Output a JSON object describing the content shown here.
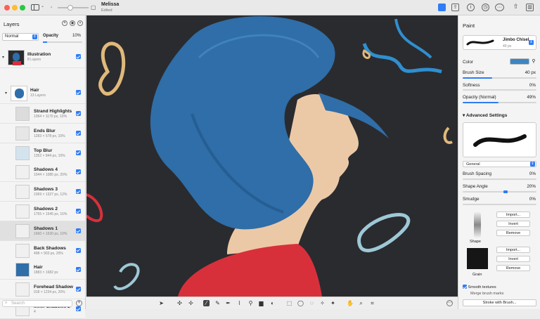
{
  "window": {
    "title": "Melissa",
    "subtitle": "Edited"
  },
  "layers_panel": {
    "title": "Layers",
    "blend_mode": "Normal",
    "opacity_label": "Opacity",
    "opacity_value": "10%",
    "opacity_fraction": 0.1,
    "search_placeholder": "Search",
    "groups": [
      {
        "name": "Illustration",
        "desc": "8 Layers"
      },
      {
        "name": "Hair",
        "desc": "13 Layers"
      }
    ],
    "layers": [
      {
        "name": "Strand Highlights",
        "desc": "1094 × 1170 px, 10%"
      },
      {
        "name": "Ends Blur",
        "desc": "1283 × 578 px, 10%"
      },
      {
        "name": "Top Blur",
        "desc": "1352 × 844 px, 10%"
      },
      {
        "name": "Shadows 4",
        "desc": "1044 × 1085 px, 20%"
      },
      {
        "name": "Shadows 3",
        "desc": "1069 × 1327 px, 12%"
      },
      {
        "name": "Shadows 2",
        "desc": "1755 × 1545 px, 15%"
      },
      {
        "name": "Shadows 1",
        "desc": "1660 × 1630 px, 10%"
      },
      {
        "name": "Back Shadows",
        "desc": "498 × 903 px, 20%"
      },
      {
        "name": "Hair",
        "desc": "1883 × 1682 px"
      },
      {
        "name": "Forehead Shadow",
        "desc": "918 × 1234 px, 20%"
      },
      {
        "name": "Inner Shadows 2",
        "desc": "4"
      }
    ]
  },
  "paint_panel": {
    "title": "Paint",
    "brush_name": "Jimbo Chisel",
    "brush_size_px": "40 px",
    "color_label": "Color",
    "color_value": "#3c86c2",
    "brush_size_label": "Brush Size",
    "brush_size_value": "40 px",
    "brush_size_fraction": 0.4,
    "softness_label": "Softness",
    "softness_value": "0%",
    "softness_fraction": 0,
    "opacity_label": "Opacity (Normal)",
    "opacity_value": "49%",
    "opacity_fraction": 0.49,
    "advanced_label": "Advanced Settings",
    "preset": "General",
    "spacing_label": "Brush Spacing",
    "spacing_value": "0%",
    "spacing_fraction": 0,
    "angle_label": "Shape Angle",
    "angle_value": "20%",
    "angle_fraction": 0.55,
    "smudge_label": "Smudge",
    "smudge_value": "0%",
    "smudge_fraction": 0,
    "import_label": "Import...",
    "invert_label": "Invert",
    "remove_label": "Remove",
    "shape_label": "Shape",
    "grain_label": "Grain",
    "smooth_label": "Smooth textures",
    "merge_label": "Merge brush marks",
    "stroke_label": "Stroke with Brush..."
  },
  "colors": {
    "accent": "#2f7cf6",
    "canvas_bg": "#2a2b2f",
    "hair": "#2f6ea8",
    "shirt": "#d8303b"
  }
}
